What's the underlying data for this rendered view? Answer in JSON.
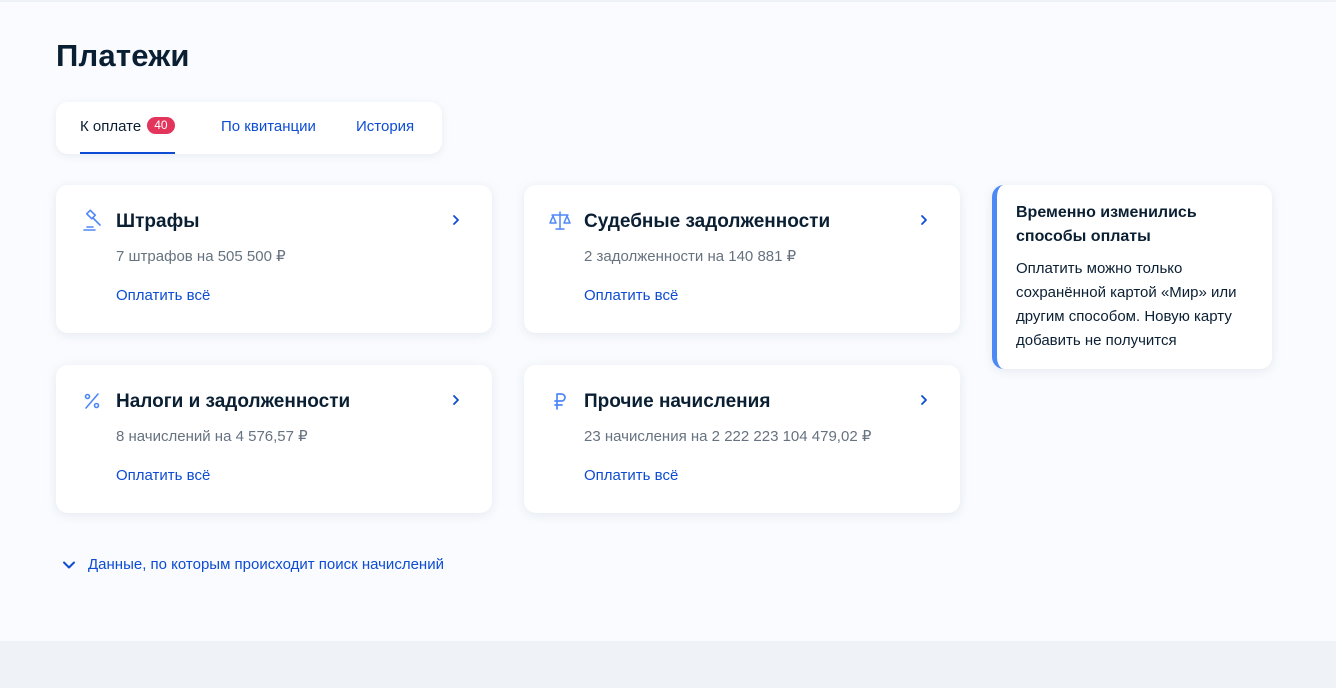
{
  "page": {
    "title": "Платежи"
  },
  "tabs": [
    {
      "label": "К оплате",
      "badge": "40",
      "active": true
    },
    {
      "label": "По квитанции",
      "active": false
    },
    {
      "label": "История",
      "active": false
    }
  ],
  "cards": [
    {
      "icon": "gavel-icon",
      "title": "Штрафы",
      "subtitle": "7 штрафов на 505 500 ₽",
      "link": "Оплатить всё"
    },
    {
      "icon": "scales-icon",
      "title": "Судебные задолженности",
      "subtitle": "2 задолженности на 140 881 ₽",
      "link": "Оплатить всё"
    },
    {
      "icon": "percent-icon",
      "title": "Налоги и задолженности",
      "subtitle": "8 начислений на 4 576,57 ₽",
      "link": "Оплатить всё"
    },
    {
      "icon": "ruble-icon",
      "title": "Прочие начисления",
      "subtitle": "23 начисления на 2 222 223 104 479,02 ₽",
      "link": "Оплатить всё"
    }
  ],
  "notice": {
    "title": "Временно изменились способы оплаты",
    "text": "Оплатить можно только сохранённой картой «Мир» или другим способом. Новую карту добавить не получится",
    "accent": "#4d88f7"
  },
  "search_toggle": {
    "label": "Данные, по которым происходит поиск начислений",
    "icon": "chevron-down-icon"
  },
  "colors": {
    "link": "#0d4cd3",
    "badge": "#e3355c",
    "text": "#0b1f33",
    "muted": "#66727f"
  }
}
